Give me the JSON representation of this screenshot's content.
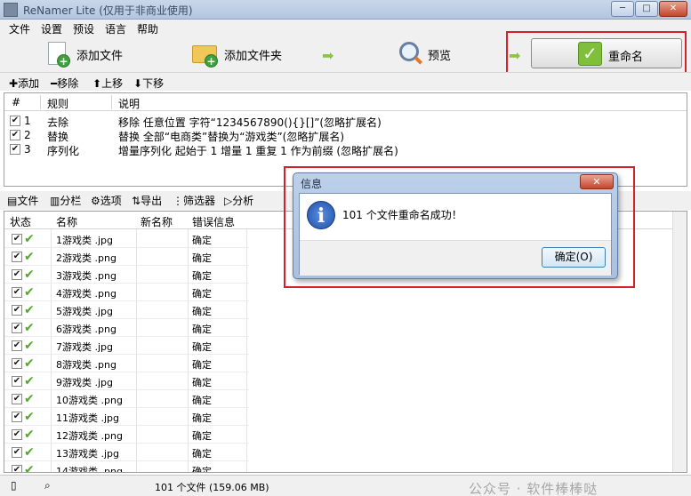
{
  "window": {
    "title": "ReNamer Lite (仅用于非商业使用)",
    "buttons": [
      "─",
      "□",
      "✕"
    ]
  },
  "menu": [
    "文件",
    "设置",
    "预设",
    "语言",
    "帮助"
  ],
  "toolbar": {
    "add_files": "添加文件",
    "add_folder": "添加文件夹",
    "preview": "预览",
    "rename": "重命名"
  },
  "rules_toolbar": {
    "add": "添加",
    "remove": "移除",
    "up": "上移",
    "down": "下移"
  },
  "rules": {
    "headers": [
      "#",
      "规则",
      "说明"
    ],
    "rows": [
      {
        "num": "1",
        "rule": "去除",
        "desc": "移除 任意位置 字符“1234567890(){}[]”(忽略扩展名)",
        "checked": true
      },
      {
        "num": "2",
        "rule": "替换",
        "desc": "替换 全部“电商类”替换为“游戏类”(忽略扩展名)",
        "checked": true
      },
      {
        "num": "3",
        "rule": "序列化",
        "desc": "增量序列化 起始于 1 增量 1 重复 1 作为前缀 (忽略扩展名)",
        "checked": true
      }
    ]
  },
  "files_toolbar": {
    "files": "文件",
    "columns": "分栏",
    "options": "选项",
    "export": "导出",
    "filter": "筛选器",
    "analyze": "分析"
  },
  "files": {
    "headers": [
      "状态",
      "名称",
      "新名称",
      "错误信息"
    ],
    "rows": [
      {
        "name": "1游戏类 .jpg",
        "error": "确定"
      },
      {
        "name": "2游戏类 .png",
        "error": "确定"
      },
      {
        "name": "3游戏类 .png",
        "error": "确定"
      },
      {
        "name": "4游戏类 .png",
        "error": "确定"
      },
      {
        "name": "5游戏类 .jpg",
        "error": "确定"
      },
      {
        "name": "6游戏类 .png",
        "error": "确定"
      },
      {
        "name": "7游戏类 .jpg",
        "error": "确定"
      },
      {
        "name": "8游戏类 .png",
        "error": "确定"
      },
      {
        "name": "9游戏类 .jpg",
        "error": "确定"
      },
      {
        "name": "10游戏类 .png",
        "error": "确定"
      },
      {
        "name": "11游戏类 .jpg",
        "error": "确定"
      },
      {
        "name": "12游戏类 .png",
        "error": "确定"
      },
      {
        "name": "13游戏类 .jpg",
        "error": "确定"
      },
      {
        "name": "14游戏类 .png",
        "error": "确定"
      }
    ]
  },
  "status": {
    "file_count": "101 个文件 (159.06 MB)"
  },
  "watermark": "公众号 · 软件棒棒哒",
  "dialog": {
    "title": "信息",
    "close": "✕",
    "message": "101 个文件重命名成功！",
    "ok_label": "确定(O)"
  },
  "colors": {
    "highlight_red": "#d4202a",
    "check_green": "#53a82e"
  }
}
